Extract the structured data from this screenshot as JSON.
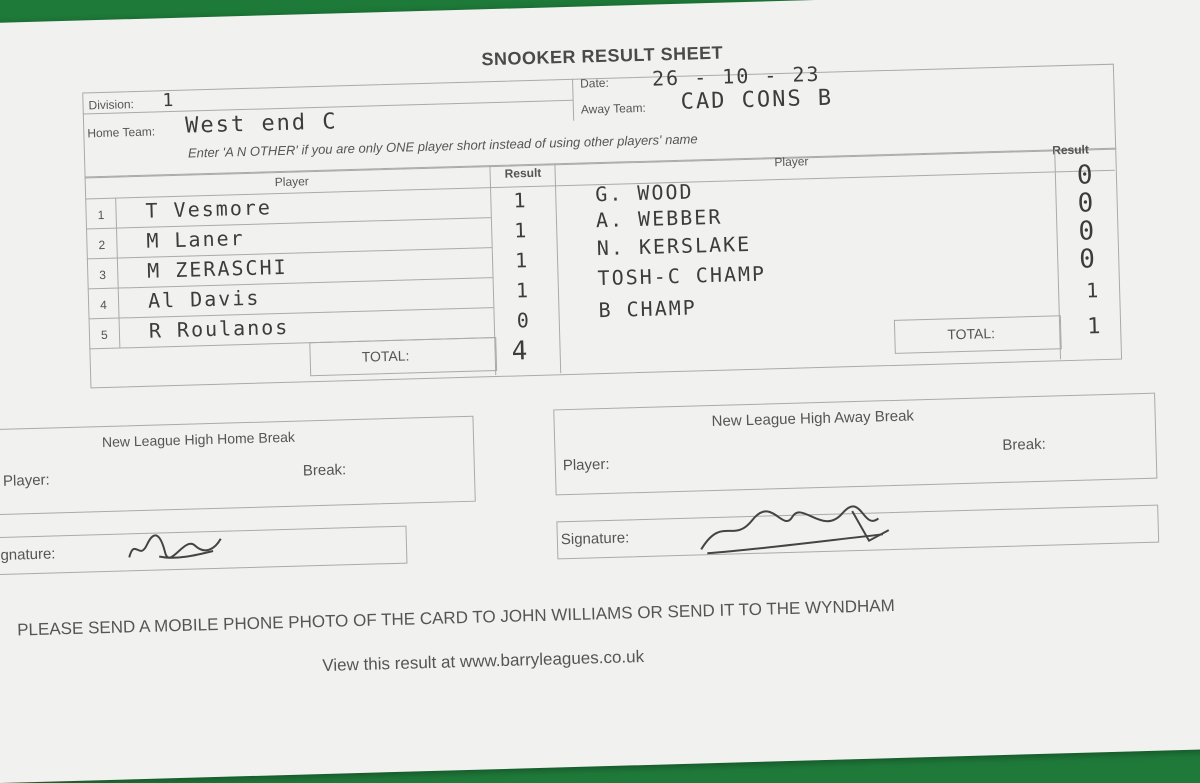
{
  "sheet": {
    "title": "SNOOKER RESULT SHEET",
    "division_label": "Division:",
    "division_value": "1",
    "date_label": "Date:",
    "date_value": "26 - 10 - 23",
    "home_team_label": "Home Team:",
    "home_team_value": "West end C",
    "away_team_label": "Away Team:",
    "away_team_value": "CAD CONS B",
    "instruction": "Enter 'A N OTHER' if you are only ONE player short instead of using other players' name"
  },
  "table": {
    "home_player_header": "Player",
    "home_result_header": "Result",
    "away_player_header": "Player",
    "away_result_header": "Result",
    "home_total_label": "TOTAL:",
    "home_total_value": "4",
    "away_total_label": "TOTAL:",
    "away_total_value": "1",
    "rows": [
      {
        "num": "1",
        "home_player": "T  Vesmore",
        "home_result": "1",
        "away_player": "G. WOOD",
        "away_result": "0"
      },
      {
        "num": "2",
        "home_player": "M   Laner",
        "home_result": "1",
        "away_player": "A. WEBBER",
        "away_result": "0"
      },
      {
        "num": "3",
        "home_player": "M  ZERASCHI",
        "home_result": "1",
        "away_player": "N. KERSLAKE",
        "away_result": "0"
      },
      {
        "num": "4",
        "home_player": "Al  Davis",
        "home_result": "1",
        "away_player": "TOSH-C CHAMP",
        "away_result": "0"
      },
      {
        "num": "5",
        "home_player": "R  Roulanos",
        "home_result": "0",
        "away_player": "B CHAMP",
        "away_result": "1"
      }
    ]
  },
  "breaks": {
    "home_title": "New League High Home Break",
    "away_title": "New League High Away Break",
    "player_label": "Player:",
    "break_label": "Break:"
  },
  "signatures": {
    "label": "Signature:"
  },
  "footer": {
    "line1": "PLEASE SEND A MOBILE PHONE PHOTO OF THE CARD TO JOHN WILLIAMS OR SEND IT TO THE WYNDHAM",
    "line2": "View this result at www.barryleagues.co.uk"
  }
}
